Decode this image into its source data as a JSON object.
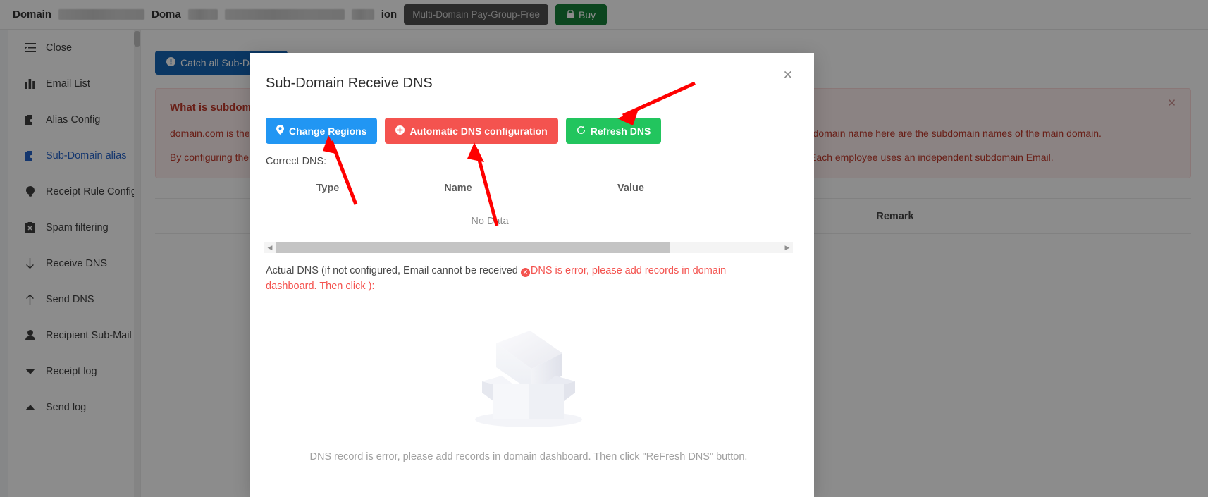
{
  "topbar": {
    "domain_label": "Domain",
    "domain2_label": "Doma",
    "ion_label": "ion",
    "plan_badge": "Multi-Domain Pay-Group-Free",
    "buy_label": "Buy",
    "buy_icon": "lock-icon",
    "buy_color": "#17803a"
  },
  "sidebar": {
    "items": [
      {
        "label": "Close",
        "icon": "collapse-icon",
        "active": false
      },
      {
        "label": "Email List",
        "icon": "bar-chart-icon",
        "active": false
      },
      {
        "label": "Alias Config",
        "icon": "wallet-icon",
        "active": false
      },
      {
        "label": "Sub-Domain alias",
        "icon": "wallet-icon",
        "active": true
      },
      {
        "label": "Receipt Rule Config",
        "icon": "lightbulb-icon",
        "active": false
      },
      {
        "label": "Spam filtering",
        "icon": "clipboard-x-icon",
        "active": false
      },
      {
        "label": "Receive DNS",
        "icon": "arrow-down-icon",
        "active": false
      },
      {
        "label": "Send DNS",
        "icon": "arrow-up-icon",
        "active": false
      },
      {
        "label": "Recipient Sub-Mail",
        "icon": "user-icon",
        "active": false
      },
      {
        "label": "Receipt log",
        "icon": "caret-down-icon",
        "active": false
      },
      {
        "label": "Send log",
        "icon": "caret-up-icon",
        "active": false
      }
    ]
  },
  "main": {
    "catch_all_button": "Catch all Sub-Domain",
    "catch_all_icon": "info-circle-icon",
    "info": {
      "title": "What is subdomain alias?",
      "paragraph1": "domain.com is the main domain name, and a.domain.com, b.domain.com are the subdomain name. The second-level domain name and third-level domain name here are the subdomain names of the main domain.",
      "paragraph2": "By configuring the subdomain, the Email suffix can be configured as @a.domain.com. It is very convenient for employee permission management. Each employee uses an independent subdomain Email.",
      "close_icon": "close-icon"
    },
    "table": {
      "columns": [
        "Remark"
      ]
    }
  },
  "modal": {
    "title": "Sub-Domain Receive DNS",
    "close_icon": "close-icon",
    "buttons": [
      {
        "label": "Change Regions",
        "icon": "location-pin-icon",
        "color": "#2196f3"
      },
      {
        "label": "Automatic DNS configuration",
        "icon": "plus-circle-icon",
        "color": "#f4534f"
      },
      {
        "label": "Refresh DNS",
        "icon": "refresh-icon",
        "color": "#22c55e"
      }
    ],
    "correct_dns_label": "Correct DNS:",
    "dns_table": {
      "columns": [
        "Type",
        "Name",
        "Value"
      ],
      "rows": [],
      "empty_text": "No Data"
    },
    "scrollbar": {
      "left_arrow_icon": "chevron-left-icon",
      "right_arrow_icon": "chevron-right-icon"
    },
    "actual_dns": {
      "prefix": "Actual DNS (if not configured, Email cannot be received ",
      "error_icon": "error-circle-icon",
      "error_text": "DNS is error, please add records in domain dashboard. Then click ",
      "suffix": "):"
    },
    "empty_state": {
      "illustration": "empty-box-icon",
      "caption": "DNS record is error, please add records in domain dashboard. Then click \"ReFresh DNS\" button."
    }
  },
  "annotations": {
    "arrow_color": "#ff0000",
    "arrow_count": 3
  }
}
